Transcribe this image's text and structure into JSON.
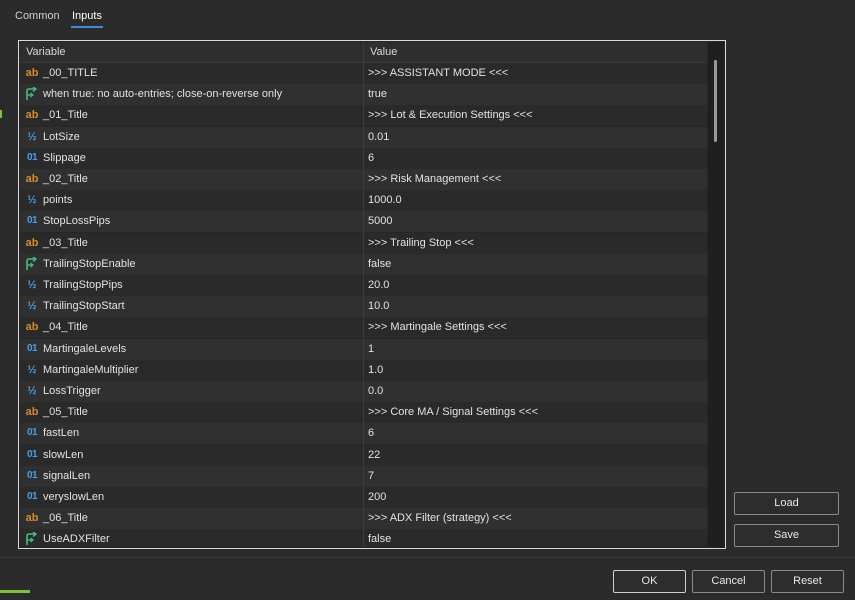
{
  "tabs": [
    {
      "label": "Common"
    },
    {
      "label": "Inputs"
    }
  ],
  "table": {
    "headers": {
      "variable": "Variable",
      "value": "Value"
    },
    "rows": [
      {
        "icon": "ab",
        "name": "_00_TITLE",
        "value": ">>> ASSISTANT MODE <<<"
      },
      {
        "icon": "bool",
        "name": "when true: no auto-entries; close-on-reverse only",
        "value": "true"
      },
      {
        "icon": "ab",
        "name": "_01_Title",
        "value": ">>> Lot & Execution Settings <<<"
      },
      {
        "icon": "dbl",
        "name": "LotSize",
        "value": "0.01"
      },
      {
        "icon": "int",
        "name": "Slippage",
        "value": "6"
      },
      {
        "icon": "ab",
        "name": "_02_Title",
        "value": ">>> Risk Management <<<"
      },
      {
        "icon": "dbl",
        "name": "points",
        "value": "1000.0"
      },
      {
        "icon": "int",
        "name": "StopLossPips",
        "value": "5000"
      },
      {
        "icon": "ab",
        "name": "_03_Title",
        "value": ">>> Trailing Stop <<<"
      },
      {
        "icon": "bool",
        "name": "TrailingStopEnable",
        "value": "false"
      },
      {
        "icon": "dbl",
        "name": "TrailingStopPips",
        "value": "20.0"
      },
      {
        "icon": "dbl",
        "name": "TrailingStopStart",
        "value": "10.0"
      },
      {
        "icon": "ab",
        "name": "_04_Title",
        "value": ">>> Martingale Settings <<<"
      },
      {
        "icon": "int",
        "name": "MartingaleLevels",
        "value": "1"
      },
      {
        "icon": "dbl",
        "name": "MartingaleMultiplier",
        "value": "1.0"
      },
      {
        "icon": "dbl",
        "name": "LossTrigger",
        "value": "0.0"
      },
      {
        "icon": "ab",
        "name": "_05_Title",
        "value": ">>> Core MA / Signal Settings <<<"
      },
      {
        "icon": "int",
        "name": "fastLen",
        "value": "6"
      },
      {
        "icon": "int",
        "name": "slowLen",
        "value": "22"
      },
      {
        "icon": "int",
        "name": "signalLen",
        "value": "7"
      },
      {
        "icon": "int",
        "name": "veryslowLen",
        "value": "200"
      },
      {
        "icon": "ab",
        "name": "_06_Title",
        "value": ">>> ADX Filter (strategy) <<<"
      },
      {
        "icon": "bool",
        "name": "UseADXFilter",
        "value": "false"
      }
    ]
  },
  "side_buttons": {
    "load": "Load",
    "save": "Save"
  },
  "buttons": {
    "ok": "OK",
    "cancel": "Cancel",
    "reset": "Reset"
  },
  "colors": {
    "string_icon": "#d98a2b",
    "number_icon": "#4a9ee8",
    "bool_icon": "#3fbf7f",
    "accent": "#3a8fd8"
  }
}
